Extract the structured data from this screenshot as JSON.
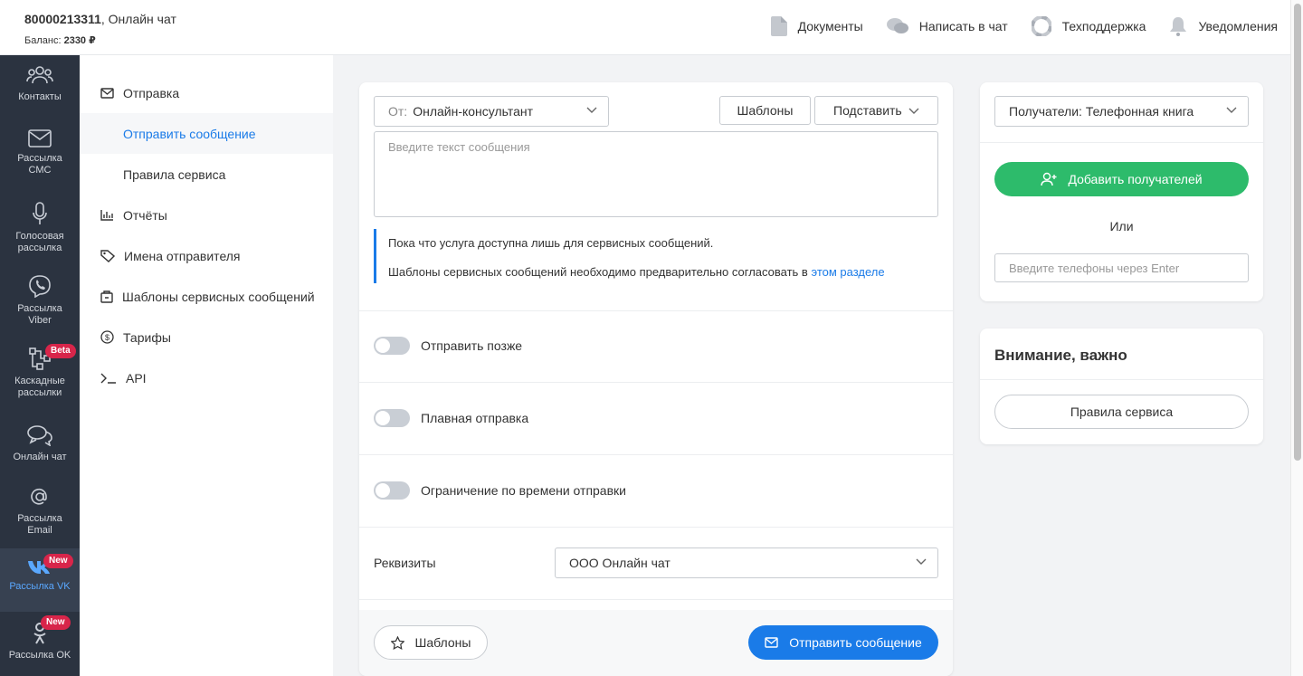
{
  "account": {
    "phone": "80000213311",
    "name": ", Онлайн чат",
    "balance_label": "Баланс:",
    "balance_value": "2330 ₽"
  },
  "topnav": {
    "documents": "Документы",
    "write_chat": "Написать в чат",
    "support": "Техподдержка",
    "notifications": "Уведомления"
  },
  "rail": {
    "contacts": "Контакты",
    "sms_1": "Рассылка",
    "sms_2": "СМС",
    "voice_1": "Голосовая",
    "voice_2": "рассылка",
    "viber_1": "Рассылка",
    "viber_2": "Viber",
    "cascade_1": "Каскадные",
    "cascade_2": "рассылки",
    "cascade_badge": "Beta",
    "chat": "Онлайн чат",
    "email_1": "Рассылка",
    "email_2": "Email",
    "vk": "Рассылка VK",
    "vk_badge": "New",
    "ok": "Рассылка OK",
    "ok_badge": "New"
  },
  "subnav": {
    "send": "Отправка",
    "send_message": "Отправить сообщение",
    "service_rules": "Правила сервиса",
    "reports": "Отчёты",
    "sender_names": "Имена отправителя",
    "service_templates": "Шаблоны сервисных сообщений",
    "tariffs": "Тарифы",
    "api": "API"
  },
  "compose": {
    "from_prefix": "От:",
    "from_value": "Онлайн-консультант",
    "templates_btn": "Шаблоны",
    "insert_btn": "Подставить",
    "message_placeholder": "Введите текст сообщения",
    "notice_line1": "Пока что услуга доступна лишь для сервисных сообщений.",
    "notice_line2": "Шаблоны сервисных сообщений необходимо предварительно согласовать в",
    "notice_link": "этом разделе",
    "send_later": "Отправить позже",
    "smooth_send": "Плавная отправка",
    "time_limit": "Ограничение по времени отправки",
    "requisites_label": "Реквизиты",
    "requisites_value": "ООО Онлайн чат",
    "footer_templates": "Шаблоны",
    "footer_send": "Отправить сообщение"
  },
  "recipients": {
    "select_value": "Получатели: Телефонная книга",
    "add_btn": "Добавить получателей",
    "or": "Или",
    "phones_placeholder": "Введите телефоны через Enter"
  },
  "attention": {
    "title": "Внимание, важно",
    "rules_btn": "Правила сервиса"
  },
  "colors": {
    "accent": "#1a7be8",
    "green": "#2dbb6b",
    "rail": "#2b3340",
    "badge": "#d8254a"
  }
}
